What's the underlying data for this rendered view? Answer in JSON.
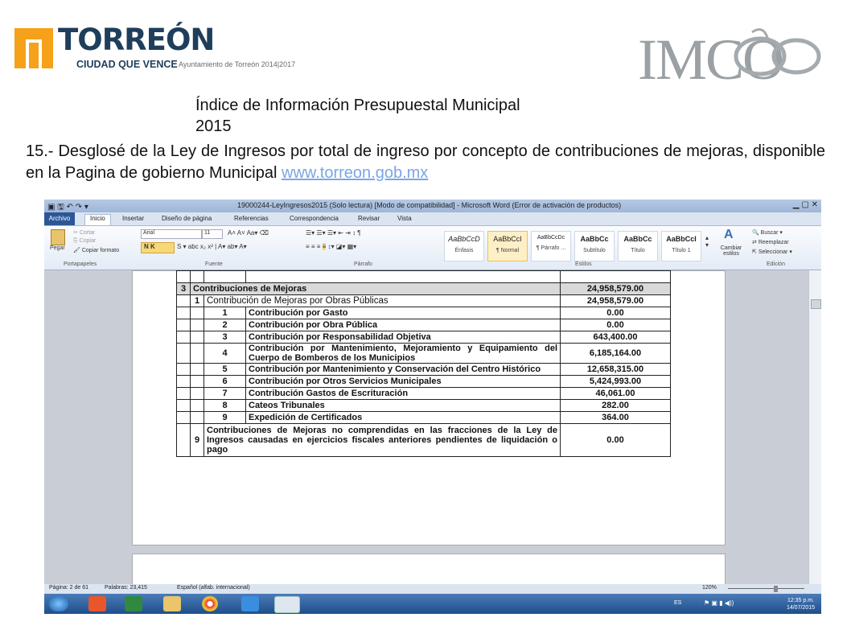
{
  "header": {
    "torreon_wordmark": "TORREÓN",
    "torreon_slogan": "CIUDAD QUE VENCE",
    "torreon_sub": "Ayuntamiento de Torreón 2014|2017",
    "imco_logo": "IMCO",
    "colors": {
      "torreon_orange": "#f5a11a",
      "torreon_navy": "#1e3e5b",
      "imco_gray": "#9aa0a4"
    }
  },
  "content": {
    "title_line1": "Índice de Información Presupuestal Municipal",
    "title_line2": "2015",
    "paragraph": "15.- Desglosé de la Ley de Ingresos por total  de ingreso por concepto de contribuciones de mejoras, disponible en la Pagina de gobierno Municipal ",
    "link": "www.torreon.gob.mx"
  },
  "word": {
    "window_title": "19000244-LeyIngresos2015 (Solo lectura) [Modo de compatibilidad] - Microsoft Word (Error de activación de productos)",
    "tabs": [
      "Archivo",
      "Inicio",
      "Insertar",
      "Diseño de página",
      "Referencias",
      "Correspondencia",
      "Revisar",
      "Vista"
    ],
    "font_name": "Arial",
    "font_size": "11",
    "clipboard": {
      "paste": "Pegar",
      "cut": "Cortar",
      "copy": "Copiar",
      "format_painter": "Copiar formato"
    },
    "styles": [
      {
        "preview": "AaBbCcD",
        "name": "Énfasis"
      },
      {
        "preview": "AaBbCcI",
        "name": "¶ Normal"
      },
      {
        "preview": "AaBbCcDc",
        "name": "¶ Párrafo ..."
      },
      {
        "preview": "AaBbCc",
        "name": "Subtítulo"
      },
      {
        "preview": "AaBbCc",
        "name": "Título"
      },
      {
        "preview": "AaBbCcI",
        "name": "Título 1"
      }
    ],
    "change_styles": "Cambiar estilos",
    "editing": {
      "find": "Buscar",
      "replace": "Reemplazar",
      "select": "Seleccionar"
    },
    "group_labels": [
      "Portapapeles",
      "Fuente",
      "Párrafo",
      "Estilos",
      "Edición"
    ],
    "status": {
      "page": "Página: 2 de 61",
      "words": "Palabras: 23,415",
      "language": "Español (alfab. internacional)",
      "zoom": "120%"
    },
    "tray": {
      "lang": "ES",
      "time": "12:35 p.m.",
      "date": "14/07/2015"
    }
  },
  "table": {
    "section": {
      "number": "3",
      "label": "Contribuciones de Mejoras",
      "amount": "24,958,579.00"
    },
    "subsection": {
      "number": "1",
      "label": "Contribución de Mejoras por Obras Públicas",
      "amount": "24,958,579.00"
    },
    "rows": [
      {
        "num": "1",
        "label": "Contribución por Gasto",
        "amount": "0.00"
      },
      {
        "num": "2",
        "label": "Contribución por Obra Pública",
        "amount": "0.00"
      },
      {
        "num": "3",
        "label": "Contribución por Responsabilidad Objetiva",
        "amount": "643,400.00"
      },
      {
        "num": "4",
        "label": "Contribución por Mantenimiento, Mejoramiento y Equipamiento del Cuerpo de Bomberos de los Municipios",
        "amount": "6,185,164.00"
      },
      {
        "num": "5",
        "label": "Contribución por Mantenimiento y Conservación del Centro Histórico",
        "amount": "12,658,315.00"
      },
      {
        "num": "6",
        "label": "Contribución por Otros Servicios Municipales",
        "amount": "5,424,993.00"
      },
      {
        "num": "7",
        "label": "Contribución Gastos de Escrituración",
        "amount": "46,061.00"
      },
      {
        "num": "8",
        "label": "Cateos Tribunales",
        "amount": "282.00"
      },
      {
        "num": "9",
        "label": "Expedición de Certificados",
        "amount": "364.00"
      }
    ],
    "last": {
      "number": "9",
      "label": "Contribuciones de Mejoras no comprendidas en las fracciones de la Ley de Ingresos causadas en ejercicios fiscales anteriores pendientes de liquidación o pago",
      "amount": "0.00"
    }
  }
}
